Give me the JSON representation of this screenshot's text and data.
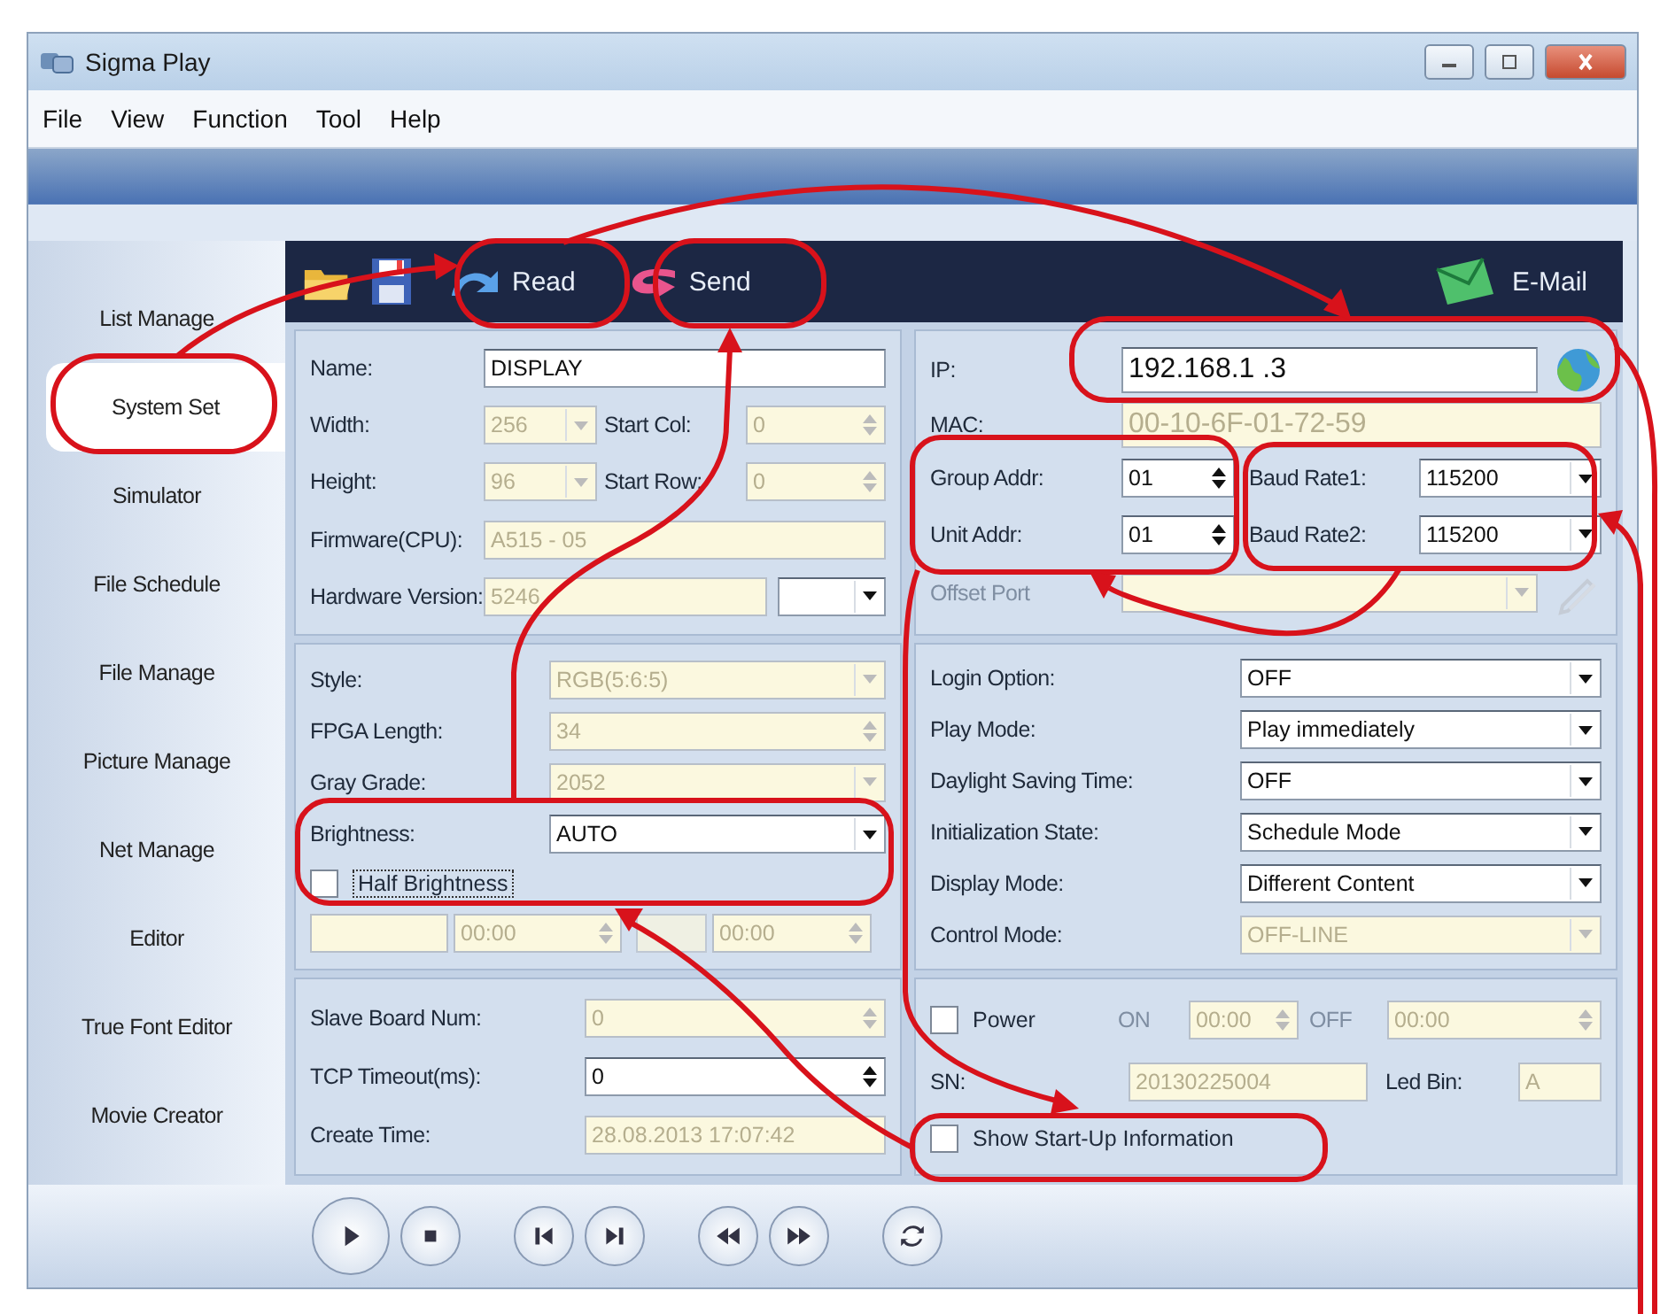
{
  "window": {
    "title": "Sigma Play"
  },
  "menu": [
    {
      "label": "File"
    },
    {
      "label": "View"
    },
    {
      "label": "Function"
    },
    {
      "label": "Tool"
    },
    {
      "label": "Help"
    }
  ],
  "sidebar": {
    "items": [
      {
        "label": "List Manage",
        "selected": false
      },
      {
        "label": "System Set",
        "selected": true
      },
      {
        "label": "Simulator",
        "selected": false
      },
      {
        "label": "File Schedule",
        "selected": false
      },
      {
        "label": "File Manage",
        "selected": false
      },
      {
        "label": "Picture Manage",
        "selected": false
      },
      {
        "label": "Net Manage",
        "selected": false
      },
      {
        "label": "Editor",
        "selected": false
      },
      {
        "label": "True Font Editor",
        "selected": false
      },
      {
        "label": "Movie Creator",
        "selected": false
      }
    ]
  },
  "toolbar": {
    "buttons": [
      {
        "kind": "read",
        "label": "Read"
      },
      {
        "kind": "send",
        "label": "Send"
      },
      {
        "kind": "email",
        "label": "E-Mail"
      }
    ]
  },
  "system": {
    "name": {
      "label": "Name:",
      "field": {
        "kind": "text",
        "value": "DISPLAY",
        "disabled": false
      }
    },
    "width": {
      "label": "Width:",
      "field": {
        "kind": "combo",
        "value": "256",
        "disabled": true
      }
    },
    "start_col": {
      "label": "Start Col:",
      "field": {
        "kind": "spin",
        "value": "0",
        "disabled": true
      }
    },
    "height": {
      "label": "Height:",
      "field": {
        "kind": "combo",
        "value": "96",
        "disabled": true
      }
    },
    "start_row": {
      "label": "Start Row:",
      "field": {
        "kind": "spin",
        "value": "0",
        "disabled": true
      }
    },
    "firmware": {
      "label": "Firmware(CPU):",
      "field": {
        "kind": "text",
        "value": "A515 - 05",
        "disabled": true
      }
    },
    "hardware_version": {
      "label": "Hardware Version:",
      "field": {
        "kind": "text",
        "value": "5246",
        "disabled": true
      },
      "extra": {
        "kind": "combo",
        "disabled": false
      }
    }
  },
  "display": {
    "style": {
      "label": "Style:",
      "field": {
        "kind": "combo",
        "value": "RGB(5:6:5)",
        "disabled": true
      }
    },
    "fpga_length": {
      "label": "FPGA Length:",
      "field": {
        "kind": "spin",
        "value": "34",
        "disabled": true
      }
    },
    "gray_grade": {
      "label": "Gray Grade:",
      "field": {
        "kind": "combo",
        "value": "2052",
        "disabled": true
      }
    },
    "brightness": {
      "label": "Brightness:",
      "field": {
        "kind": "combo",
        "value": "AUTO",
        "disabled": false
      }
    },
    "half_brightness": {
      "label": "Half Brightness",
      "checked": false
    },
    "time_range": [
      {
        "kind": "text",
        "disabled": true
      },
      {
        "kind": "spin",
        "value": "00:00",
        "disabled": true
      },
      {
        "kind": "text",
        "disabled": true
      },
      {
        "kind": "spin",
        "value": "00:00",
        "disabled": true
      }
    ]
  },
  "board": {
    "slave_board_num": {
      "label": "Slave Board Num:",
      "field": {
        "kind": "spin",
        "value": "0",
        "disabled": true
      }
    },
    "tcp_timeout": {
      "label": "TCP Timeout(ms):",
      "field": {
        "kind": "spin",
        "value": "0",
        "disabled": false
      }
    },
    "create_time": {
      "label": "Create Time:",
      "field": {
        "kind": "text",
        "value": "28.08.2013 17:07:42",
        "disabled": true
      }
    }
  },
  "network": {
    "ip": {
      "label": "IP:",
      "field": {
        "kind": "text",
        "value": "192.168.1  .3",
        "disabled": false
      }
    },
    "mac": {
      "label": "MAC:",
      "field": {
        "kind": "text",
        "value": "00-10-6F-01-72-59",
        "disabled": true
      }
    },
    "group_addr": {
      "label": "Group Addr:",
      "field": {
        "kind": "spin",
        "value": "01",
        "disabled": false
      }
    },
    "unit_addr": {
      "label": "Unit Addr:",
      "field": {
        "kind": "spin",
        "value": "01",
        "disabled": false
      }
    },
    "baud_rate1": {
      "label": "Baud Rate1:",
      "field": {
        "kind": "combo",
        "value": "115200",
        "disabled": false
      }
    },
    "baud_rate2": {
      "label": "Baud Rate2:",
      "field": {
        "kind": "combo",
        "value": "115200",
        "disabled": false
      }
    },
    "offset_port": {
      "label": "Offset Port",
      "field": {
        "kind": "combo",
        "disabled": true
      }
    }
  },
  "options": [
    {
      "label": "Login Option:",
      "field": {
        "kind": "combo",
        "value": "OFF",
        "disabled": false
      }
    },
    {
      "label": "Play Mode:",
      "field": {
        "kind": "combo",
        "value": "Play immediately",
        "disabled": false
      }
    },
    {
      "label": "Daylight Saving Time:",
      "field": {
        "kind": "combo",
        "value": "OFF",
        "disabled": false
      }
    },
    {
      "label": "Initialization State:",
      "field": {
        "kind": "combo",
        "value": "Schedule Mode",
        "disabled": false
      }
    },
    {
      "label": "Display Mode:",
      "field": {
        "kind": "combo",
        "value": "Different Content",
        "disabled": false
      }
    },
    {
      "label": "Control Mode:",
      "field": {
        "kind": "combo",
        "value": "OFF-LINE",
        "disabled": true
      }
    }
  ],
  "power": {
    "power": {
      "label": "Power",
      "checked": false
    },
    "on": {
      "label": "ON",
      "field": {
        "kind": "spin",
        "value": "00:00",
        "disabled": true
      }
    },
    "off": {
      "label": "OFF",
      "field": {
        "kind": "spin",
        "value": "00:00",
        "disabled": true
      }
    },
    "sn": {
      "label": "SN:",
      "field": {
        "kind": "text",
        "value": "20130225004",
        "disabled": true
      }
    },
    "led_bin": {
      "label": "Led Bin:",
      "field": {
        "kind": "text",
        "value": "A",
        "disabled": true
      }
    },
    "show_startup": {
      "label": "Show Start-Up Information",
      "checked": false
    }
  },
  "player": [
    {
      "kind": "play"
    },
    {
      "kind": "stop"
    },
    {
      "kind": "previous"
    },
    {
      "kind": "next"
    },
    {
      "kind": "rewind"
    },
    {
      "kind": "forward"
    },
    {
      "kind": "refresh"
    }
  ]
}
